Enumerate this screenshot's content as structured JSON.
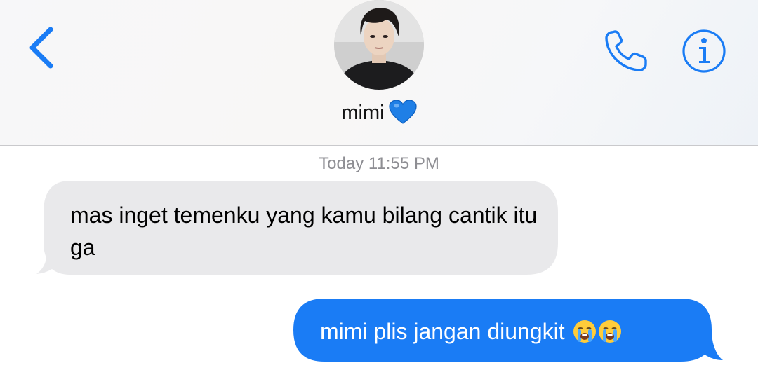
{
  "header": {
    "contact_name": "mimi",
    "name_emoji": "blue-heart-icon",
    "back_icon": "chevron-left-icon",
    "call_icon": "phone-icon",
    "info_icon": "info-icon",
    "accent_color": "#1a7cf5"
  },
  "conversation": {
    "timestamp": "Today 11:55 PM",
    "messages": [
      {
        "direction": "incoming",
        "text": "mas inget temenku yang kamu bilang cantik itu ga",
        "bubble_color": "#e9e9eb"
      },
      {
        "direction": "outgoing",
        "text": "mimi plis jangan diungkit",
        "emojis": [
          "loudly-crying-face-icon",
          "loudly-crying-face-icon"
        ],
        "bubble_color": "#1a7cf5"
      }
    ]
  }
}
